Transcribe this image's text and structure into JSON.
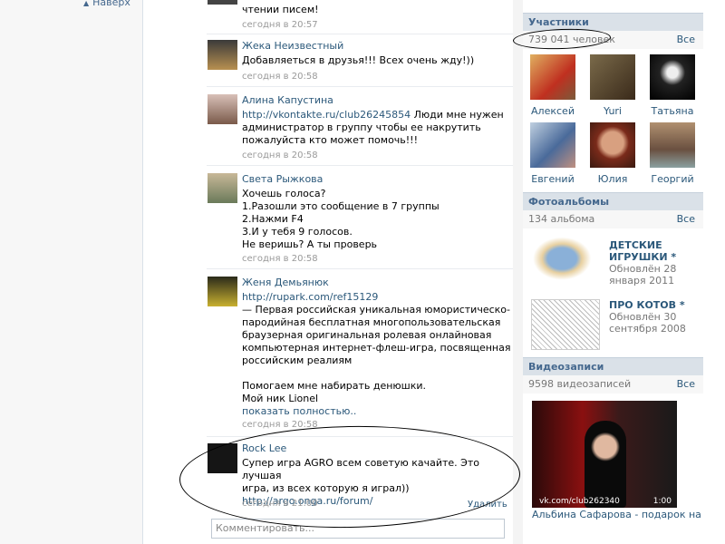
{
  "nav": {
    "back_to_top": "Наверх"
  },
  "wall": {
    "first_post_tail": "чтении писем!",
    "first_post_time": "сегодня в 20:57",
    "posts": [
      {
        "author": "Жека Неизвестный",
        "text": "Добавляеться в друзья!!! Всех очень жду!))",
        "time": "сегодня в 20:58"
      },
      {
        "author": "Алина Капустина",
        "link": "http://vkontakte.ru/club26245854",
        "text_line1": " Люди мне нужен",
        "text_line2": "администратор в группу чтобы ее накрутить",
        "text_line3": "пожалуйста кто может помочь!!!",
        "time": "сегодня в 20:58"
      },
      {
        "author": "Света Рыжкова",
        "lines": [
          "Хочешь голоса?",
          "1.Разошли это сообщение в 7 группы",
          "2.Нажми F4",
          "3.И у тебя 9 голосов.",
          "Не веришь? А ты проверь"
        ],
        "time": "сегодня в 20:58"
      },
      {
        "author": "Женя Демьянюк",
        "link": "http://rupark.com/ref15129",
        "lines": [
          "— Первая российская уникальная юмористическо-",
          "пародийная бесплатная многопользовательская",
          "браузерная оригинальная ролевая онлайновая",
          "компьютерная интернет-флеш-игра, посвященная",
          "российским реалиям"
        ],
        "lines2": [
          "Помогаем мне набирать денюшки.",
          "Мой ник Lionel"
        ],
        "more": "показать полностью..",
        "time": "сегодня в 20:58"
      },
      {
        "author": "Rock Lee",
        "lines": [
          "Супер игра AGRO всем советую качайте. Это лучшая",
          "игра, из всех которую я играл))"
        ],
        "link": "http://argo.onga.ru/forum/",
        "time": "сегодня в 21:00",
        "delete": "Удалить"
      }
    ],
    "comment_placeholder": "Комментировать..."
  },
  "sidebar": {
    "members": {
      "title": "Участники",
      "count": "739 041 человек",
      "all": "Все",
      "people": [
        {
          "name": "Алексей",
          "color": "#c87a3a"
        },
        {
          "name": "Yuri",
          "color": "#5a4a3a"
        },
        {
          "name": "Татьяна",
          "color": "#1a1a1a"
        },
        {
          "name": "Евгений",
          "color": "#8aa0b8"
        },
        {
          "name": "Юлия",
          "color": "#6a2a1a"
        },
        {
          "name": "Георгий",
          "color": "#9a7a60"
        }
      ]
    },
    "albums": {
      "title": "Фотоальбомы",
      "count": "134 альбома",
      "all": "Все",
      "items": [
        {
          "title_line1": "ДЕТСКИЕ",
          "title_line2": "ИГРУШКИ *",
          "date_line1": "Обновлён 28",
          "date_line2": "января 2011"
        },
        {
          "title_line1": "ПРО КОТОВ *",
          "date_line1": "Обновлён 30",
          "date_line2": "сентября 2008"
        }
      ]
    },
    "videos": {
      "title": "Видеозаписи",
      "count": "9598 видеозаписей",
      "all": "Все",
      "thumb_label": "vk.com/club262340",
      "duration": "1:00",
      "video_title": "Альбина Сафарова - подарок на"
    }
  }
}
